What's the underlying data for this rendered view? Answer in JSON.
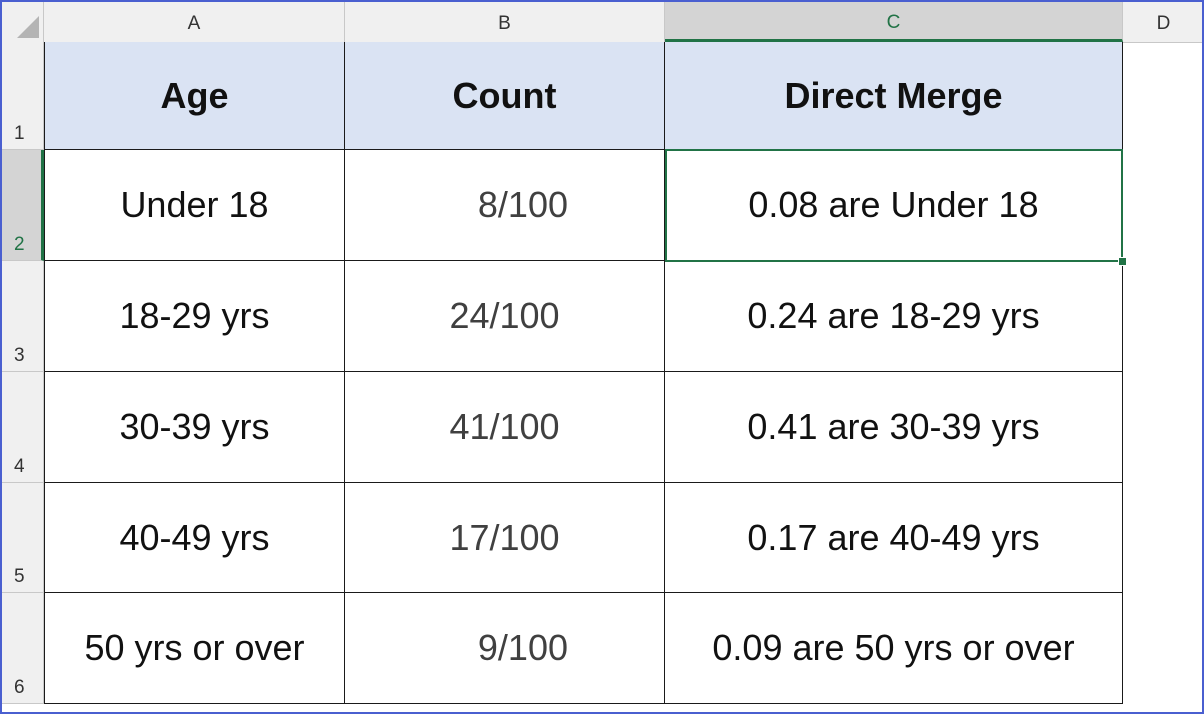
{
  "columns": [
    "A",
    "B",
    "C",
    "D"
  ],
  "rows": [
    "1",
    "2",
    "3",
    "4",
    "5",
    "6"
  ],
  "active_cell": {
    "column": "C",
    "row": "2"
  },
  "table": {
    "headers": [
      "Age",
      "Count",
      "Direct Merge"
    ],
    "data": [
      [
        "Under 18",
        "8/100",
        "0.08 are Under 18"
      ],
      [
        "18-29 yrs",
        "24/100",
        "0.24 are 18-29 yrs"
      ],
      [
        "30-39 yrs",
        "41/100",
        "0.41 are 30-39 yrs"
      ],
      [
        "40-49 yrs",
        "17/100",
        "0.17 are 40-49 yrs"
      ],
      [
        "50 yrs or over",
        "9/100",
        "0.09 are 50 yrs or over"
      ]
    ]
  },
  "colors": {
    "header_fill": "#dae3f3",
    "selection": "#217346",
    "frame": "#4a5fd0"
  }
}
